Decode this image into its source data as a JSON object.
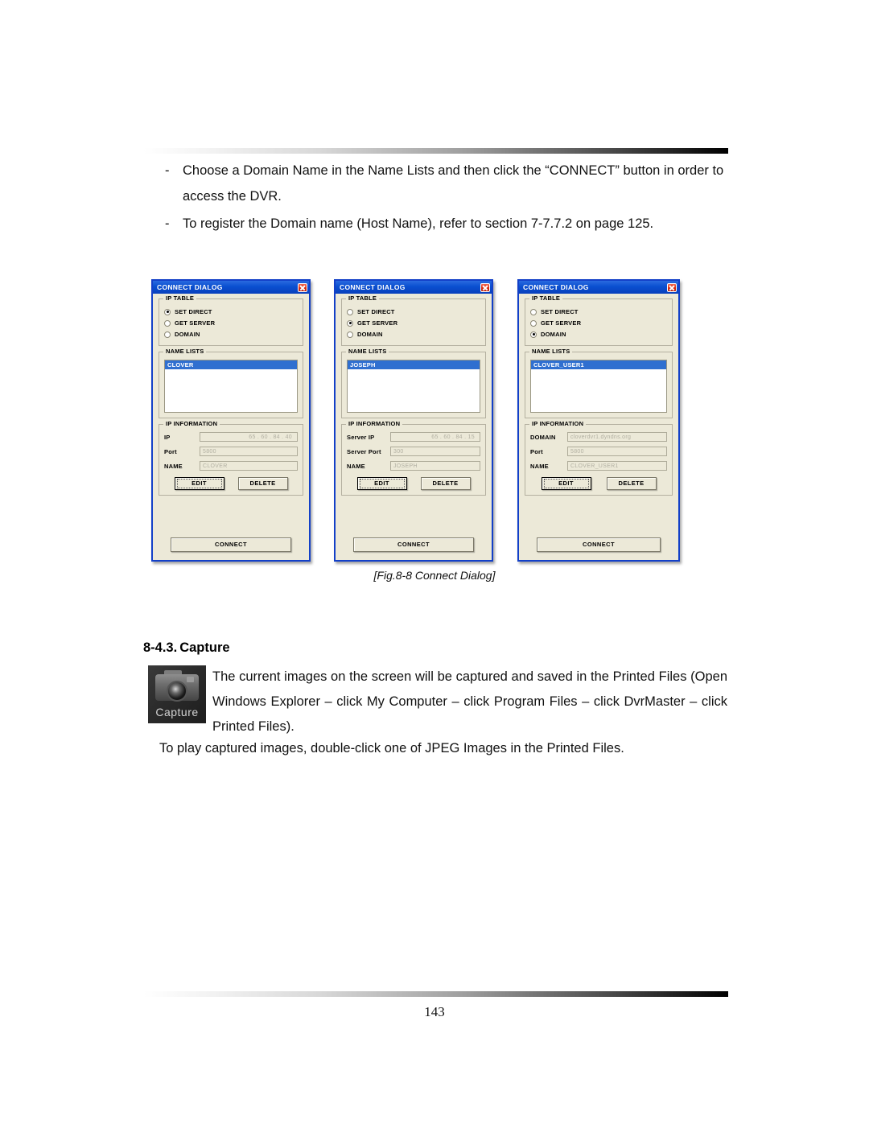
{
  "document": {
    "page_number": "143",
    "figure_caption": "[Fig.8-8 Connect Dialog]"
  },
  "intro": {
    "bullets": [
      {
        "marker": "-",
        "text": "Choose a Domain Name in the Name Lists and then click the “CONNECT” button in order to access the DVR."
      },
      {
        "marker": "-",
        "text": "To register the Domain name (Host Name), refer to section 7-7.7.2 on page 125."
      }
    ]
  },
  "dialogs": [
    {
      "title": "CONNECT DIALOG",
      "ip_table": {
        "legend": "IP TABLE",
        "options": [
          {
            "label": "SET DIRECT",
            "selected": true
          },
          {
            "label": "GET SERVER",
            "selected": false
          },
          {
            "label": "DOMAIN",
            "selected": false
          }
        ]
      },
      "name_lists": {
        "legend": "NAME LISTS",
        "selected_item": "CLOVER"
      },
      "ip_information": {
        "legend": "IP INFORMATION",
        "fields": [
          {
            "label": "IP",
            "value": "65  .  60  .  84  .  40",
            "align": "right"
          },
          {
            "label": "Port",
            "value": "5800",
            "align": "left"
          },
          {
            "label": "NAME",
            "value": "CLOVER",
            "align": "left"
          }
        ],
        "edit_label": "EDIT",
        "delete_label": "DELETE"
      },
      "connect_label": "CONNECT"
    },
    {
      "title": "CONNECT DIALOG",
      "ip_table": {
        "legend": "IP TABLE",
        "options": [
          {
            "label": "SET DIRECT",
            "selected": false
          },
          {
            "label": "GET SERVER",
            "selected": true
          },
          {
            "label": "DOMAIN",
            "selected": false
          }
        ]
      },
      "name_lists": {
        "legend": "NAME LISTS",
        "selected_item": "JOSEPH"
      },
      "ip_information": {
        "legend": "IP INFORMATION",
        "fields": [
          {
            "label": "Server IP",
            "value": "65  .  60  .  84  .  15",
            "align": "right"
          },
          {
            "label": "Server Port",
            "value": "300",
            "align": "left"
          },
          {
            "label": "NAME",
            "value": "JOSEPH",
            "align": "left"
          }
        ],
        "edit_label": "EDIT",
        "delete_label": "DELETE"
      },
      "connect_label": "CONNECT"
    },
    {
      "title": "CONNECT DIALOG",
      "ip_table": {
        "legend": "IP TABLE",
        "options": [
          {
            "label": "SET DIRECT",
            "selected": false
          },
          {
            "label": "GET SERVER",
            "selected": false
          },
          {
            "label": "DOMAIN",
            "selected": true
          }
        ]
      },
      "name_lists": {
        "legend": "NAME LISTS",
        "selected_item": "CLOVER_USER1"
      },
      "ip_information": {
        "legend": "IP INFORMATION",
        "fields": [
          {
            "label": "DOMAIN",
            "value": "cloverdvr1.dyndns.org",
            "align": "left"
          },
          {
            "label": "Port",
            "value": "5800",
            "align": "left"
          },
          {
            "label": "NAME",
            "value": "CLOVER_USER1",
            "align": "left"
          }
        ],
        "edit_label": "EDIT",
        "delete_label": "DELETE"
      },
      "connect_label": "CONNECT"
    }
  ],
  "capture_section": {
    "heading_number": "8-4.3.",
    "heading_title": "Capture",
    "icon_label": "Capture",
    "paragraph1": "The current images on the screen will be captured and saved in the Printed Files (Open Windows Explorer – click My Computer – click Program Files – click DvrMaster – click Printed Files).",
    "paragraph2": "To play captured images, double-click one of JPEG Images in the Printed Files."
  }
}
